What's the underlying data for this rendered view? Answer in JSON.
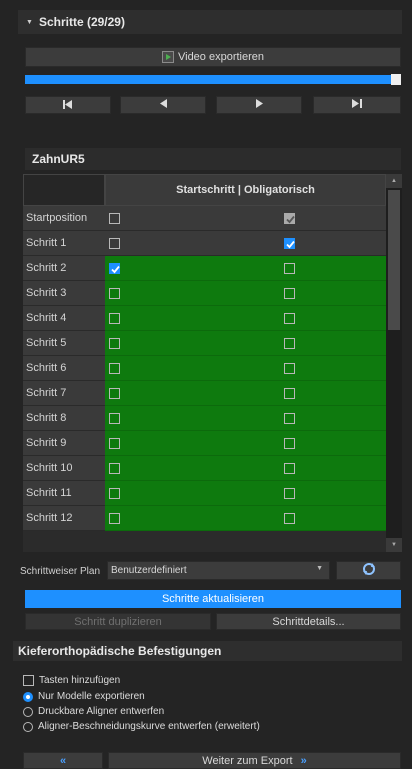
{
  "steps_panel": {
    "title": "Schritte (29/29)",
    "video_export_label": "Video exportieren",
    "progress": 1.0
  },
  "playback": {
    "first_label": "⏮",
    "prev_label": "◀",
    "play_label": "▶",
    "last_label": "⏭"
  },
  "table": {
    "title": "ZahnUR5",
    "column_header": "Startschritt | Obligatorisch",
    "rows": [
      {
        "label": "Startposition",
        "start": false,
        "mandatory": true,
        "style": "grey"
      },
      {
        "label": "Schritt 1",
        "start": false,
        "mandatory": true,
        "style": "grey"
      },
      {
        "label": "Schritt 2",
        "start": true,
        "mandatory": false,
        "style": "green"
      },
      {
        "label": "Schritt 3",
        "start": false,
        "mandatory": false,
        "style": "green"
      },
      {
        "label": "Schritt 4",
        "start": false,
        "mandatory": false,
        "style": "green"
      },
      {
        "label": "Schritt 5",
        "start": false,
        "mandatory": false,
        "style": "green"
      },
      {
        "label": "Schritt 6",
        "start": false,
        "mandatory": false,
        "style": "green"
      },
      {
        "label": "Schritt 7",
        "start": false,
        "mandatory": false,
        "style": "green"
      },
      {
        "label": "Schritt 8",
        "start": false,
        "mandatory": false,
        "style": "green"
      },
      {
        "label": "Schritt 9",
        "start": false,
        "mandatory": false,
        "style": "green"
      },
      {
        "label": "Schritt 10",
        "start": false,
        "mandatory": false,
        "style": "green"
      },
      {
        "label": "Schritt 11",
        "start": false,
        "mandatory": false,
        "style": "green"
      },
      {
        "label": "Schritt 12",
        "start": false,
        "mandatory": false,
        "style": "green"
      }
    ]
  },
  "plan": {
    "label": "Schrittweiser Plan",
    "selected": "Benutzerdefiniert",
    "update_label": "Schritte aktualisieren",
    "duplicate_label": "Schritt duplizieren",
    "details_label": "Schrittdetails..."
  },
  "attachments": {
    "title": "Kieferorthopädische Befestigungen",
    "add_keys_label": "Tasten hinzufügen",
    "options": [
      {
        "label": "Nur Modelle exportieren",
        "selected": true
      },
      {
        "label": "Druckbare Aligner entwerfen",
        "selected": false
      },
      {
        "label": "Aligner-Beschneidungskurve entwerfen (erweitert)",
        "selected": false
      }
    ]
  },
  "footer": {
    "next_label": "Weiter zum Export"
  },
  "colors": {
    "accent": "#1e90ff",
    "green": "#0e7a0e"
  }
}
